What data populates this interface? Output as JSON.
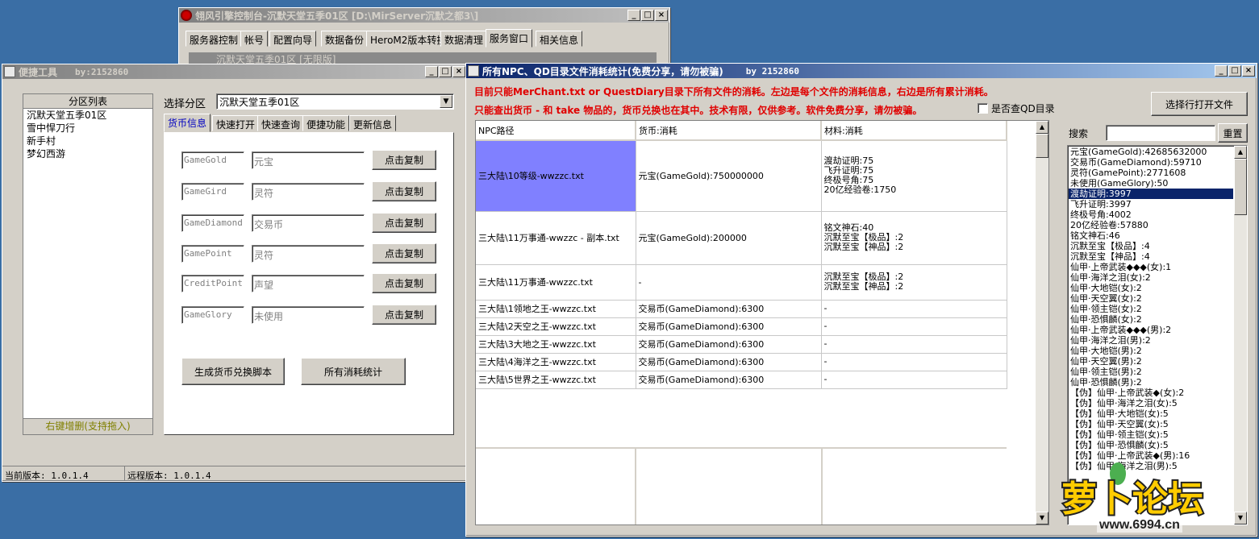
{
  "colors": {
    "desktop": "#3a6ea5",
    "title_active": "#0a246a",
    "selection": "#0a246a",
    "highlight_cell": "#8080ff",
    "warning_red": "#e00000"
  },
  "console": {
    "title": "翎风引擎控制台-沉默天堂五季01区 [D:\\MirServer沉默之都3\\]",
    "menu": [
      "服务器控制",
      "帐号",
      "配置向导",
      "数据备份",
      "HeroM2版本转换",
      "数据清理",
      "服务窗口",
      "相关信息"
    ],
    "inner_title": "沉默天堂五季01区 [无限版]"
  },
  "tool": {
    "title": "便捷工具",
    "by": "by:2152860",
    "list_header": "分区列表",
    "partitions": [
      "沉默天堂五季01区",
      "雪中悍刀行",
      "新手村",
      "梦幻西游"
    ],
    "list_footer": "右键增删(支持拖入)",
    "select_label": "选择分区",
    "select_value": "沉默天堂五季01区",
    "tabs": [
      "货币信息",
      "快速打开",
      "快速查询",
      "便捷功能",
      "更新信息"
    ],
    "currency_rows": [
      {
        "code": "GameGold",
        "name": "元宝",
        "button": "点击复制"
      },
      {
        "code": "GameGird",
        "name": "灵符",
        "button": "点击复制"
      },
      {
        "code": "GameDiamond",
        "name": "交易币",
        "button": "点击复制"
      },
      {
        "code": "GamePoint",
        "name": "灵符",
        "button": "点击复制"
      },
      {
        "code": "CreditPoint",
        "name": "声望",
        "button": "点击复制"
      },
      {
        "code": "GameGlory",
        "name": "未使用",
        "button": "点击复制"
      }
    ],
    "gen_button": "生成货币兑换脚本",
    "stats_button": "所有消耗统计",
    "status_current": "当前版本: 1.0.1.4",
    "status_remote": "远程版本: 1.0.1.4"
  },
  "stats": {
    "title": "所有NPC、QD目录文件消耗统计(免费分享，请勿被骗)",
    "by": "by 2152860",
    "line1": "目前只能MerChant.txt or QuestDiary目录下所有文件的消耗。左边是每个文件的消耗信息，右边是所有累计消耗。",
    "line2": "只能查出货币 - 和 take 物品的，货币兑换也在其中。技术有限，仅供参考。软件免费分享，请勿被骗。",
    "checkbox_label": "是否查QD目录",
    "open_button": "选择行打开文件",
    "search_label": "搜索",
    "reset_button": "重置",
    "headers": [
      "NPC路径",
      "货币:消耗",
      "材料:消耗"
    ],
    "rows": [
      {
        "path": "三大陆\\10等级-wwzzc.txt",
        "currency": "元宝(GameGold):750000000",
        "materials": [
          "渡劫证明:75",
          "飞升证明:75",
          "终极号角:75",
          "20亿经验卷:1750"
        ]
      },
      {
        "path": "三大陆\\11万事通-wwzzc - 副本.txt",
        "currency": "元宝(GameGold):200000",
        "materials": [
          "铭文神石:40",
          "沉默至宝【极品】:2",
          "沉默至宝【神品】:2"
        ]
      },
      {
        "path": "三大陆\\11万事通-wwzzc.txt",
        "currency": "-",
        "materials": [
          "沉默至宝【极品】:2",
          "沉默至宝【神品】:2"
        ]
      },
      {
        "path": "三大陆\\1领地之王-wwzzc.txt",
        "currency": "交易币(GameDiamond):6300",
        "materials": [
          "-"
        ]
      },
      {
        "path": "三大陆\\2天空之王-wwzzc.txt",
        "currency": "交易币(GameDiamond):6300",
        "materials": [
          "-"
        ]
      },
      {
        "path": "三大陆\\3大地之王-wwzzc.txt",
        "currency": "交易币(GameDiamond):6300",
        "materials": [
          "-"
        ]
      },
      {
        "path": "三大陆\\4海洋之王-wwzzc.txt",
        "currency": "交易币(GameDiamond):6300",
        "materials": [
          "-"
        ]
      },
      {
        "path": "三大陆\\5世界之王-wwzzc.txt",
        "currency": "交易币(GameDiamond):6300",
        "materials": [
          "-"
        ]
      }
    ],
    "totals": [
      "元宝(GameGold):42685632000",
      "交易币(GameDiamond):59710",
      "灵符(GamePoint):2771608",
      "未使用(GameGlory):50",
      "渡劫证明:3997",
      "飞升证明:3997",
      "终极号角:4002",
      "20亿经验卷:57880",
      "铭文神石:46",
      "沉默至宝【极品】:4",
      "沉默至宝【神品】:4",
      "仙甲·上帝武装◆◆◆(女):1",
      "仙甲·海洋之泪(女):2",
      "仙甲·大地铠(女):2",
      "仙甲·天空翼(女):2",
      "仙甲·领主铠(女):2",
      "仙甲·恐惧麟(女):2",
      "仙甲·上帝武装◆◆◆(男):2",
      "仙甲·海洋之泪(男):2",
      "仙甲·大地铠(男):2",
      "仙甲·天空翼(男):2",
      "仙甲·领主铠(男):2",
      "仙甲·恐惧麟(男):2",
      "【伪】仙甲·上帝武装◆(女):2",
      "【伪】仙甲·海洋之泪(女):5",
      "【伪】仙甲·大地铠(女):5",
      "【伪】仙甲·天空翼(女):5",
      "【伪】仙甲·领主铠(女):5",
      "【伪】仙甲·恐惧麟(女):5",
      "【伪】仙甲·上帝武装◆(男):16",
      "【伪】仙甲·海洋之泪(男):5"
    ],
    "selected_total": 4
  },
  "watermark": {
    "logo": "萝卜论坛",
    "url": "www.6994.cn"
  }
}
